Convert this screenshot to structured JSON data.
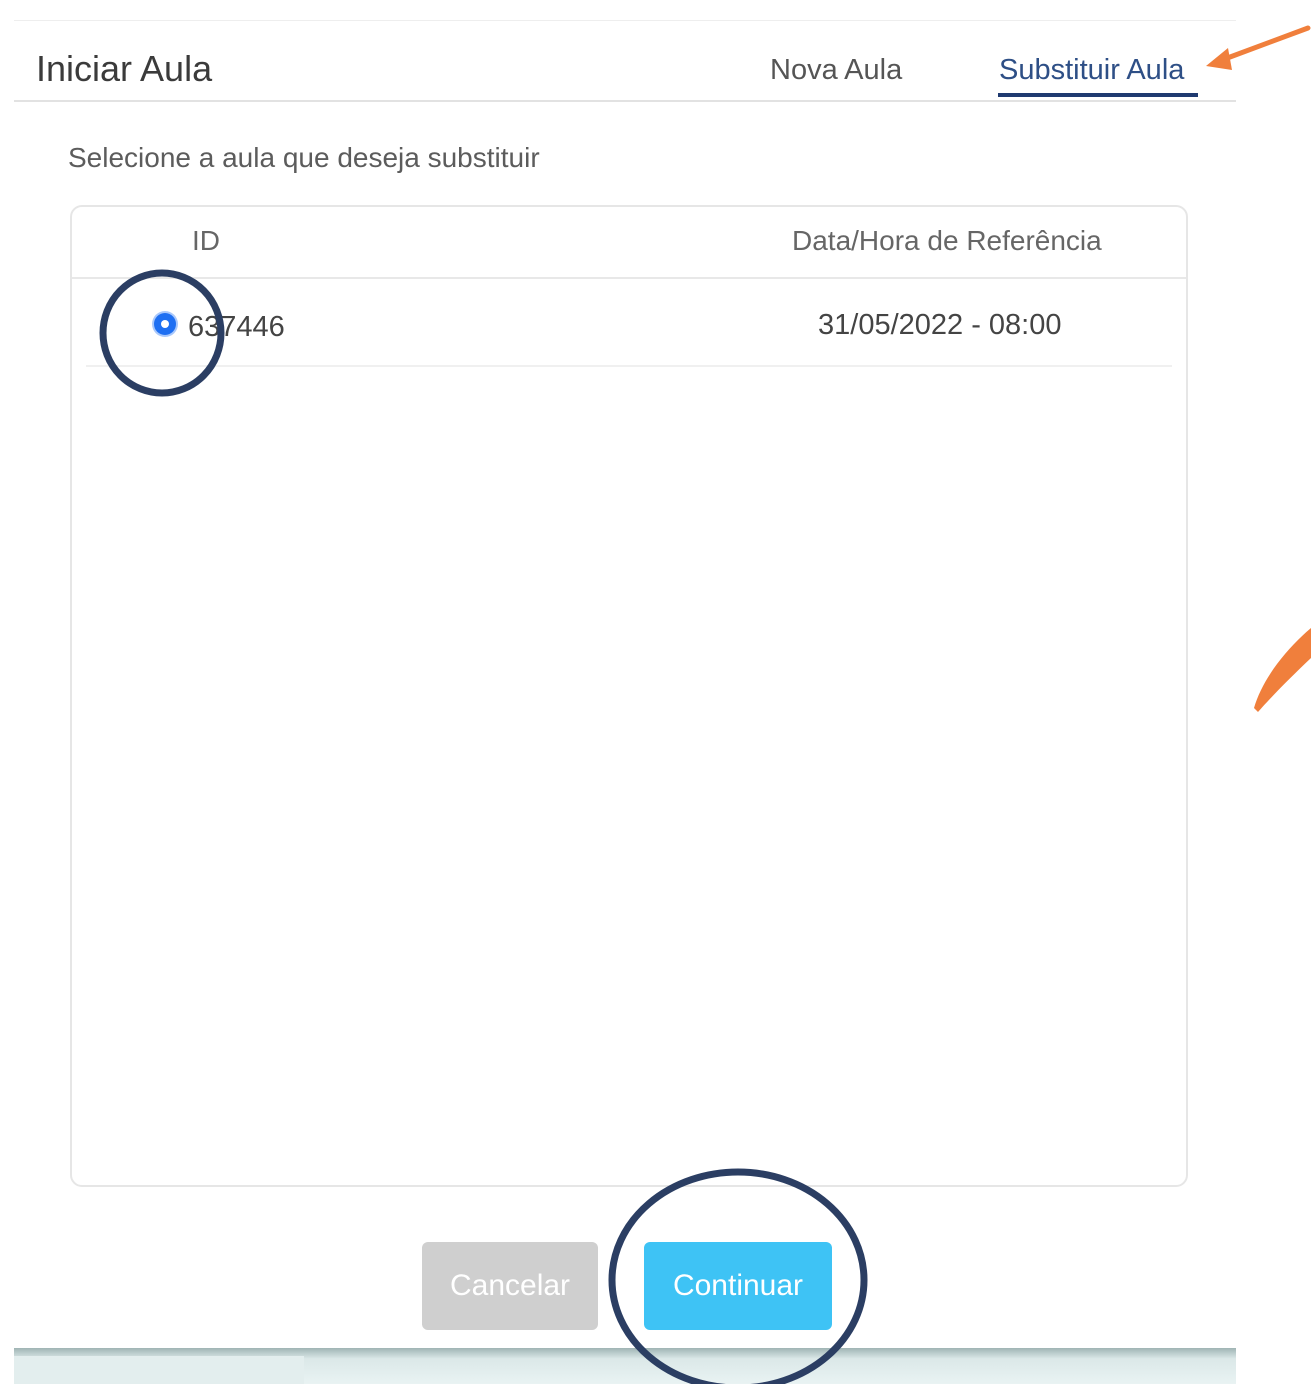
{
  "header": {
    "title": "Iniciar Aula",
    "tabs": [
      "Nova Aula",
      "Substituir Aula"
    ],
    "active_tab": "Substituir Aula"
  },
  "instructions": "Selecione a aula que deseja substituir",
  "table": {
    "columns": [
      "ID",
      "Data/Hora de Referência"
    ],
    "rows": [
      {
        "id": "637446",
        "datetime": "31/05/2022 - 08:00",
        "selected": true
      }
    ]
  },
  "buttons": {
    "cancel": "Cancelar",
    "continue": "Continuar"
  },
  "colors": {
    "accent": "#3ec3f5",
    "tab_active": "#1f3a70",
    "radio": "#1e6ff2",
    "annotation_circle": "#2b3e63",
    "annotation_arrow": "#f07f3c"
  }
}
